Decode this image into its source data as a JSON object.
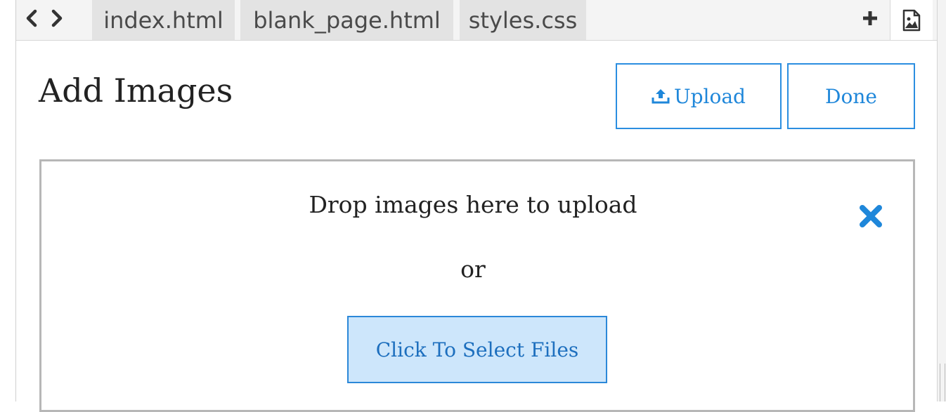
{
  "tabs": [
    {
      "label": "index.html"
    },
    {
      "label": "blank_page.html"
    },
    {
      "label": "styles.css"
    }
  ],
  "icons": {
    "back": "chevron-left-icon",
    "forward": "chevron-right-icon",
    "add": "plus-icon",
    "image": "image-file-icon",
    "upload": "upload-icon",
    "close": "close-icon"
  },
  "panel": {
    "title": "Add Images",
    "upload_label": "Upload",
    "done_label": "Done"
  },
  "dropzone": {
    "message": "Drop images here to upload",
    "or": "or",
    "select_label": "Click To Select Files"
  },
  "colors": {
    "accent": "#1f87da",
    "select_bg": "#cde6fb"
  }
}
